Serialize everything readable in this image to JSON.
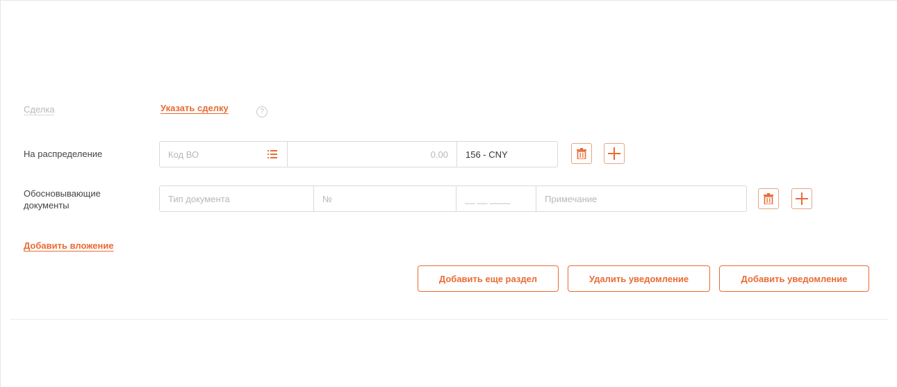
{
  "deal": {
    "label": "Сделка",
    "link": "Указать сделку",
    "help_symbol": "?"
  },
  "distribution": {
    "label": "На распределение",
    "code_placeholder": "Код ВО",
    "amount": "0.00",
    "currency": "156 - CNY"
  },
  "documents": {
    "label_line1": "Обосновывающие",
    "label_line2": "документы",
    "type_placeholder": "Тип документа",
    "number_placeholder": "№",
    "date_placeholder": "__ __ ____",
    "note_placeholder": "Примечание"
  },
  "attachment": {
    "link": "Добавить вложение"
  },
  "actions": {
    "add_section": "Добавить еще раздел",
    "delete_notification": "Удалить уведомление",
    "add_notification": "Добавить уведомление"
  },
  "colors": {
    "accent": "#ea6a34",
    "border": "#d9d9d9",
    "placeholder": "#b8b8b8"
  },
  "icons": [
    "help-icon",
    "list-icon",
    "trash-icon",
    "plus-icon"
  ]
}
